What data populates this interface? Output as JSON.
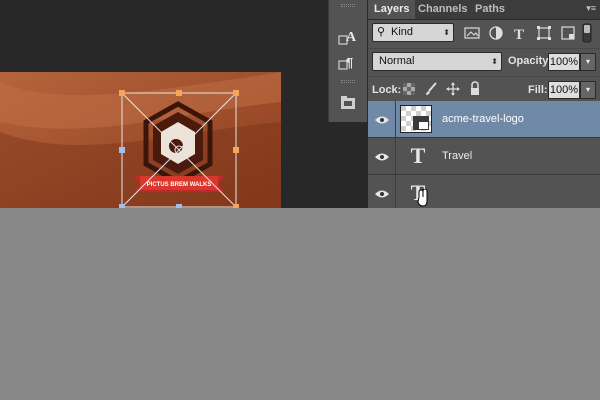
{
  "panel": {
    "tabs": [
      {
        "label": "Layers",
        "active": true
      },
      {
        "label": "Channels",
        "active": false
      },
      {
        "label": "Paths",
        "active": false
      }
    ],
    "filter": {
      "label": "Kind",
      "icon": "search-icon"
    },
    "blend_mode": "Normal",
    "opacity": {
      "label": "Opacity:",
      "value": "100%"
    },
    "lock": {
      "label": "Lock:"
    },
    "fill": {
      "label": "Fill:",
      "value": "100%"
    }
  },
  "layers": [
    {
      "name": "acme-travel-logo",
      "kind": "smart-object",
      "visible": true,
      "selected": true
    },
    {
      "name": "Travel",
      "kind": "type",
      "visible": true,
      "selected": false
    },
    {
      "name": "",
      "kind": "type",
      "visible": true,
      "selected": false
    }
  ],
  "canvas": {
    "ribbon_text": "PICTUS BREM WALKS",
    "background_color": "#a8502b",
    "selection_color": "#f5a65c"
  },
  "tool_strip": {
    "icons": [
      "character-icon",
      "paragraph-icon",
      "folder-icon"
    ]
  }
}
